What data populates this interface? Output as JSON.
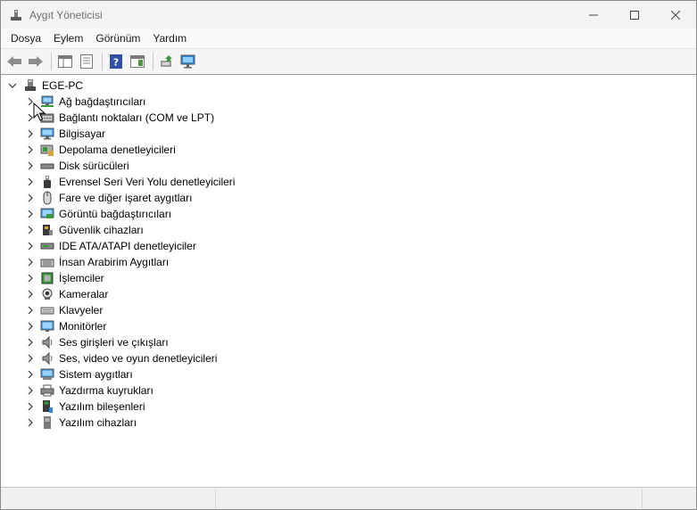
{
  "window": {
    "title": "Aygıt Yöneticisi",
    "controls": [
      "minimize",
      "maximize",
      "close"
    ]
  },
  "menu": [
    "Dosya",
    "Eylem",
    "Görünüm",
    "Yardım"
  ],
  "toolbar": {
    "buttons": [
      "back-arrow-icon",
      "forward-arrow-icon",
      "show-hide-console-tree-icon",
      "properties-icon",
      "help-icon",
      "action-pane-icon",
      "update-driver-icon",
      "scan-hardware-icon"
    ]
  },
  "tree": {
    "root": {
      "label": "EGE-PC",
      "expanded": true,
      "icon": "computer-icon"
    },
    "categories": [
      {
        "label": "Ağ bağdaştırıcıları",
        "icon": "network-adapter-icon"
      },
      {
        "label": "Bağlantı noktaları (COM ve LPT)",
        "icon": "port-icon"
      },
      {
        "label": "Bilgisayar",
        "icon": "computer-icon"
      },
      {
        "label": "Depolama denetleyicileri",
        "icon": "storage-controller-icon"
      },
      {
        "label": "Disk sürücüleri",
        "icon": "disk-drive-icon"
      },
      {
        "label": "Evrensel Seri Veri Yolu denetleyicileri",
        "icon": "usb-icon"
      },
      {
        "label": "Fare ve diğer işaret aygıtları",
        "icon": "mouse-icon"
      },
      {
        "label": "Görüntü bağdaştırıcıları",
        "icon": "display-adapter-icon"
      },
      {
        "label": "Güvenlik cihazları",
        "icon": "security-device-icon"
      },
      {
        "label": "IDE ATA/ATAPI denetleyiciler",
        "icon": "ide-controller-icon"
      },
      {
        "label": "İnsan Arabirim Aygıtları",
        "icon": "hid-icon"
      },
      {
        "label": "İşlemciler",
        "icon": "processor-icon"
      },
      {
        "label": "Kameralar",
        "icon": "camera-icon"
      },
      {
        "label": "Klavyeler",
        "icon": "keyboard-icon"
      },
      {
        "label": "Monitörler",
        "icon": "monitor-icon"
      },
      {
        "label": "Ses girişleri ve çıkışları",
        "icon": "speaker-icon"
      },
      {
        "label": "Ses, video ve oyun denetleyicileri",
        "icon": "sound-controller-icon"
      },
      {
        "label": "Sistem aygıtları",
        "icon": "system-device-icon"
      },
      {
        "label": "Yazdırma kuyrukları",
        "icon": "printer-icon"
      },
      {
        "label": "Yazılım bileşenleri",
        "icon": "software-component-icon"
      },
      {
        "label": "Yazılım cihazları",
        "icon": "software-device-icon"
      }
    ]
  },
  "colors": {
    "accent": "#0078d4",
    "titlebar": "#f3f3f3",
    "text": "#000000"
  }
}
